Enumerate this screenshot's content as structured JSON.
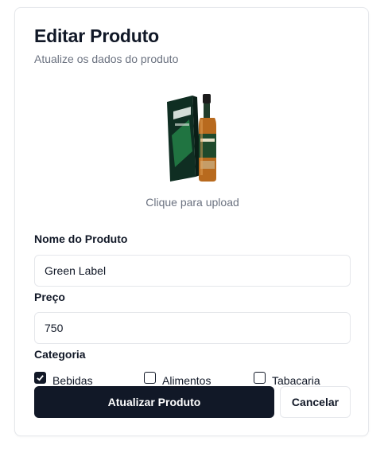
{
  "header": {
    "title": "Editar Produto",
    "subtitle": "Atualize os dados do produto"
  },
  "upload": {
    "label": "Clique para upload",
    "image_icon": "whisky-bottle-with-box-image"
  },
  "form": {
    "name_label": "Nome do Produto",
    "name_value": "Green Label",
    "price_label": "Preço",
    "price_value": "750",
    "category_label": "Categoria",
    "categories": [
      {
        "label": "Bebidas",
        "checked": true
      },
      {
        "label": "Alimentos",
        "checked": false
      },
      {
        "label": "Tabacaria",
        "checked": false
      }
    ]
  },
  "actions": {
    "submit_label": "Atualizar Produto",
    "cancel_label": "Cancelar"
  },
  "colors": {
    "primary": "#111827",
    "border": "#e5e7eb",
    "muted_text": "#6b7280"
  }
}
